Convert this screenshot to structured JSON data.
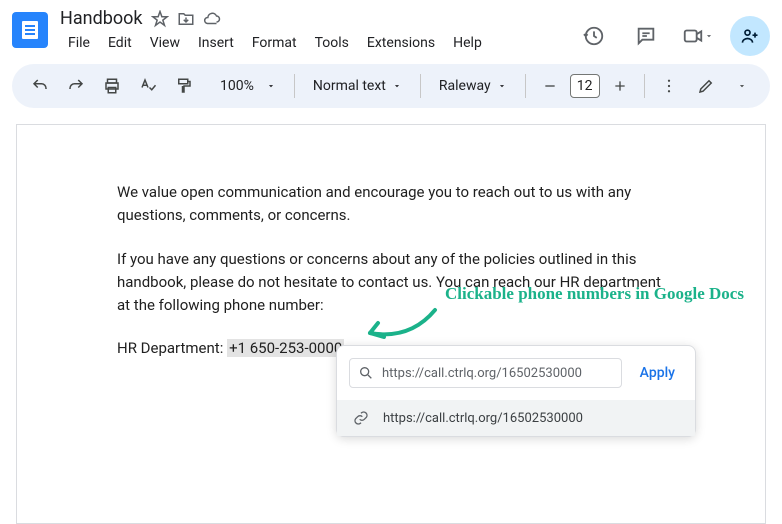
{
  "header": {
    "title": "Handbook"
  },
  "menu": {
    "file": "File",
    "edit": "Edit",
    "view": "View",
    "insert": "Insert",
    "format": "Format",
    "tools": "Tools",
    "extensions": "Extensions",
    "help": "Help"
  },
  "toolbar": {
    "zoom": "100%",
    "style": "Normal text",
    "font": "Raleway",
    "size": "12"
  },
  "document": {
    "p1": "We value open communication and encourage you to reach out to us with any questions, comments, or concerns.",
    "p2": "If you have any questions or concerns about any of the policies outlined in this handbook, please do not hesitate to contact us. You can reach our HR department at the following phone number:",
    "p3_prefix": "HR Department: ",
    "p3_phone": "+1 650-253-0000"
  },
  "callout": "Clickable phone numbers in Google Docs",
  "popup": {
    "url": "https://call.ctrlq.org/16502530000",
    "apply": "Apply",
    "result": "https://call.ctrlq.org/16502530000"
  }
}
